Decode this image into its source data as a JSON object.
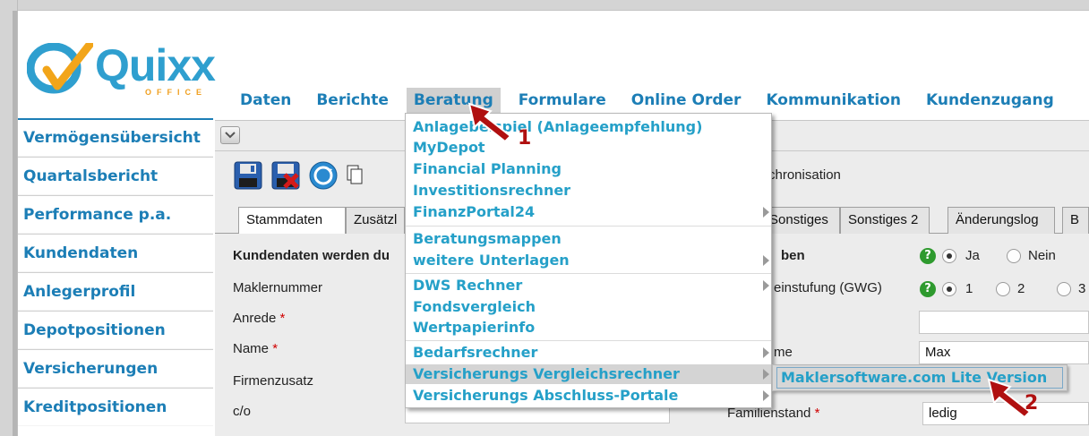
{
  "app": {
    "logo_text": "Quixx",
    "logo_subtitle": "OFFICE"
  },
  "topnav": {
    "items": [
      {
        "label": "Daten"
      },
      {
        "label": "Berichte"
      },
      {
        "label": "Beratung",
        "active": true
      },
      {
        "label": "Formulare"
      },
      {
        "label": "Online Order"
      },
      {
        "label": "Kommunikation"
      },
      {
        "label": "Kundenzugang"
      }
    ]
  },
  "sidebar": {
    "items": [
      {
        "label": "Vermögensübersicht"
      },
      {
        "label": "Quartalsbericht"
      },
      {
        "label": "Performance p.a."
      },
      {
        "label": "Kundendaten"
      },
      {
        "label": "Anlegerprofil"
      },
      {
        "label": "Depotpositionen"
      },
      {
        "label": "Versicherungen"
      },
      {
        "label": "Kreditpositionen"
      }
    ]
  },
  "toolbar": {
    "buttons": [
      {
        "icon": "save-icon"
      },
      {
        "icon": "delete-save-icon"
      },
      {
        "icon": "sync-icon"
      },
      {
        "icon": "copy-icon"
      }
    ],
    "sync_label": "chronisation"
  },
  "tabs": {
    "items": [
      {
        "label": "Stammdaten",
        "active": true
      },
      {
        "label": "Zusätzl"
      },
      {
        "label": "Sonstiges"
      },
      {
        "label": "Sonstiges 2"
      },
      {
        "label": "Änderungslog"
      },
      {
        "label": "B"
      }
    ]
  },
  "form": {
    "header": "Kundendaten werden du",
    "right_header": "ben",
    "labels": {
      "maklernummer": "Maklernummer",
      "anrede": "Anrede",
      "name": "Name",
      "firmenzusatz": "Firmenzusatz",
      "co": "c/o",
      "einstufung": "einstufung (GWG)",
      "vorname_partial": "me",
      "familienstand": "Familienstand"
    },
    "required_mark": "*",
    "radio_ja": "Ja",
    "radio_nein": "Nein",
    "radio_1": "1",
    "radio_2": "2",
    "radio_3": "3",
    "vorname_value": "Max",
    "familienstand_value": "ledig"
  },
  "dropdown": {
    "items": [
      {
        "label": "Anlagebeispiel (Anlageempfehlung)",
        "submenu": false
      },
      {
        "label": "MyDepot",
        "submenu": false
      },
      {
        "label": "Financial Planning",
        "submenu": false
      },
      {
        "label": "Investitionsrechner",
        "submenu": false
      },
      {
        "label": "FinanzPortal24",
        "submenu": true
      },
      {
        "label": "Beratungsmappen",
        "submenu": false
      },
      {
        "label": "weitere Unterlagen",
        "submenu": true
      },
      {
        "label": "DWS Rechner",
        "submenu": true
      },
      {
        "label": "Fondsvergleich",
        "submenu": false
      },
      {
        "label": "Wertpapierinfo",
        "submenu": false
      },
      {
        "label": "Bedarfsrechner",
        "submenu": true
      },
      {
        "label": "Versicherungs Vergleichsrechner",
        "submenu": true,
        "highlight": true
      },
      {
        "label": "Versicherungs Abschluss-Portale",
        "submenu": true
      }
    ]
  },
  "submenu": {
    "item": "Maklersoftware.com Lite Version"
  },
  "callouts": {
    "one": "1",
    "two": "2"
  },
  "colors": {
    "link_blue": "#1c7eb6",
    "menu_cyan": "#25a0c8",
    "callout_red": "#b01010",
    "help_green": "#2e9a2e"
  }
}
